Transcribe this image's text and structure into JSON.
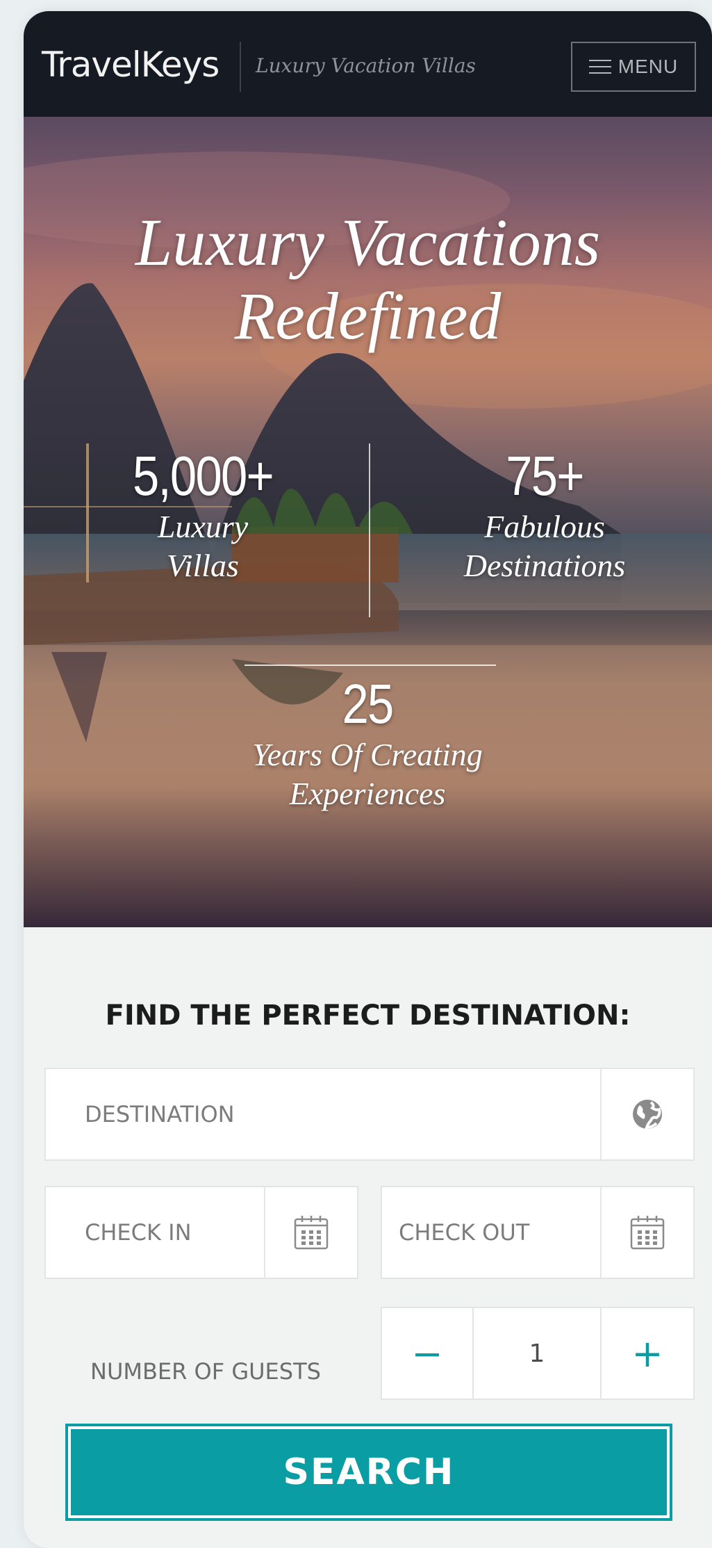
{
  "header": {
    "logo": "TravelKeys",
    "tagline": "Luxury Vacation Villas",
    "menu_label": "MENU"
  },
  "hero": {
    "title_line1": "Luxury Vacations",
    "title_line2": "Redefined",
    "stats": [
      {
        "number": "5,000+",
        "label_line1": "Luxury",
        "label_line2": "Villas"
      },
      {
        "number": "75+",
        "label_line1": "Fabulous",
        "label_line2": "Destinations"
      },
      {
        "number": "25",
        "label_line1": "Years Of Creating",
        "label_line2": "Experiences"
      }
    ]
  },
  "search_form": {
    "title": "FIND THE PERFECT DESTINATION:",
    "destination_placeholder": "DESTINATION",
    "check_in_placeholder": "CHECK IN",
    "check_out_placeholder": "CHECK OUT",
    "guests_label": "NUMBER OF GUESTS",
    "guests_value": "1",
    "decrement_symbol": "−",
    "increment_symbol": "+",
    "search_label": "SEARCH"
  },
  "icons": {
    "destination": "globe-icon",
    "check_in": "calendar-icon",
    "check_out": "calendar-icon",
    "menu": "hamburger-icon"
  },
  "colors": {
    "header_bg": "#161a22",
    "accent": "#0b9da4",
    "page_bg": "#f1f2f2"
  }
}
